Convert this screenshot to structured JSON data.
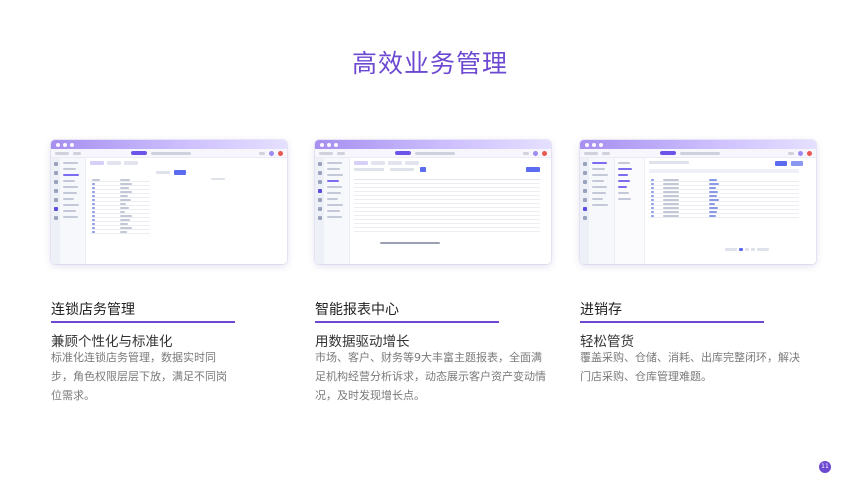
{
  "page": {
    "title": "高效业务管理",
    "page_number": "11"
  },
  "colors": {
    "accent": "#6d49d2",
    "titlebar": "#a68ff0",
    "primary_button": "#5b6cf0",
    "notification": "#e8584f"
  },
  "features": [
    {
      "title": "连锁店务管理",
      "subtitle": "兼顾个性化与标准化",
      "description": "标准化连锁店务管理，数据实时同步，角色权限层层下放，满足不同岗位需求。"
    },
    {
      "title": "智能报表中心",
      "subtitle": "用数据驱动增长",
      "description": "市场、客户、财务等9大丰富主题报表，全面满足机构经营分析诉求，动态展示客户资产变动情况，及时发现增长点。"
    },
    {
      "title": "进销存",
      "subtitle": "轻松管货",
      "description": "覆盖采购、仓储、消耗、出库完整闭环，解决门店采购、仓库管理难题。"
    }
  ]
}
